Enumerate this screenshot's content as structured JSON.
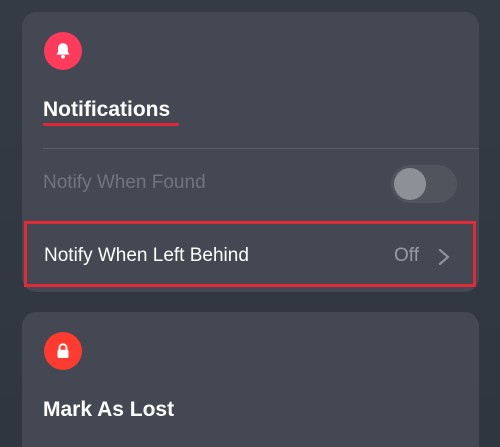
{
  "notifications": {
    "icon": "bell-icon",
    "title": "Notifications",
    "accent_color": "#ff3b5c",
    "notify_when_found": {
      "label": "Notify When Found",
      "enabled": false
    },
    "notify_when_left_behind": {
      "label": "Notify When Left Behind",
      "value": "Off",
      "icon": "chevron-right-icon"
    }
  },
  "mark_as_lost": {
    "icon": "lock-icon",
    "title": "Mark As Lost",
    "accent_color": "#ff3b30"
  },
  "highlight_color": "#e02a36"
}
